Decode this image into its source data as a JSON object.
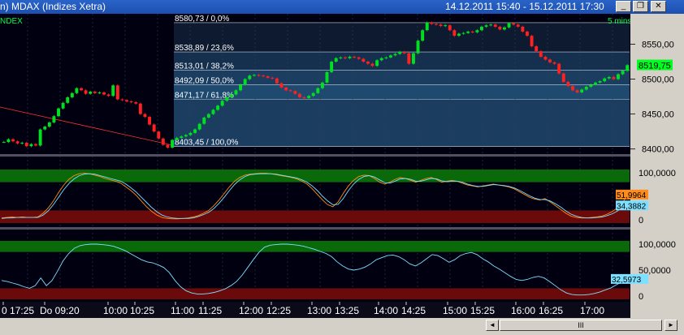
{
  "window": {
    "title": "n)   MDAX (Indizes Xetra)",
    "range": "14.12.2011 15:40 - 15.12.2011 17:30",
    "minimize": "_",
    "restore": "❐",
    "close": "✕"
  },
  "chart_data": [
    {
      "type": "candlestick",
      "instrument_label": "NDEX",
      "interval": "5 mins",
      "ylim": [
        8395,
        8590
      ],
      "yticks": [
        8550,
        8500,
        8450,
        8400
      ],
      "ytick_labels": [
        "8550,00",
        "8500,00",
        "8450,00",
        "8400,00"
      ],
      "last_price": 8519.75,
      "last_price_label": "8519,75",
      "fib_levels": [
        {
          "value": 8580.73,
          "label": "8580,73 / 0,0%"
        },
        {
          "value": 8538.89,
          "label": "8538,89 / 23,6%"
        },
        {
          "value": 8513.01,
          "label": "8513,01 / 38,2%"
        },
        {
          "value": 8492.09,
          "label": "8492,09 / 50,0%"
        },
        {
          "value": 8471.17,
          "label": "8471,17 / 61,8%"
        },
        {
          "value": 8403.45,
          "label": "8403,45 / 100,0%"
        }
      ],
      "trendline": {
        "from": [
          "Do 09:20",
          8460
        ],
        "to": [
          "11:00",
          8405
        ]
      },
      "close": [
        8410,
        8414,
        8411,
        8408,
        8409,
        8404,
        8407,
        8405,
        8428,
        8432,
        8438,
        8447,
        8458,
        8466,
        8474,
        8480,
        8487,
        8484,
        8479,
        8482,
        8480,
        8481,
        8478,
        8476,
        8491,
        8471,
        8470,
        8468,
        8467,
        8465,
        8450,
        8446,
        8435,
        8425,
        8415,
        8406,
        8402,
        8413,
        8416,
        8418,
        8420,
        8423,
        8428,
        8436,
        8445,
        8450,
        8456,
        8462,
        8469,
        8474,
        8478,
        8484,
        8492,
        8500,
        8505,
        8506,
        8505,
        8504,
        8502,
        8501,
        8494,
        8488,
        8484,
        8483,
        8479,
        8474,
        8473,
        8476,
        8480,
        8487,
        8495,
        8510,
        8525,
        8530,
        8531,
        8530,
        8532,
        8531,
        8529,
        8525,
        8522,
        8519,
        8527,
        8530,
        8531,
        8534,
        8536,
        8539,
        8537,
        8522,
        8537,
        8555,
        8570,
        8581,
        8579,
        8578,
        8576,
        8577,
        8570,
        8562,
        8565,
        8566,
        8568,
        8567,
        8570,
        8575,
        8577,
        8578,
        8575,
        8571,
        8574,
        8580,
        8578,
        8575,
        8568,
        8562,
        8547,
        8540,
        8532,
        8528,
        8524,
        8522,
        8508,
        8496,
        8490,
        8484,
        8481,
        8485,
        8489,
        8492,
        8495,
        8497,
        8501,
        8503,
        8500,
        8507,
        8512,
        8520
      ]
    },
    {
      "type": "line",
      "indicator": "stochastic",
      "ylim": [
        0,
        100
      ],
      "ytick_labels": [
        "100,0000",
        "0"
      ],
      "series": [
        {
          "color": "#ff8c1a",
          "values": [
            4,
            5,
            6,
            5,
            6,
            5,
            5,
            6,
            14,
            25,
            40,
            58,
            74,
            86,
            94,
            98,
            99,
            98,
            95,
            92,
            88,
            85,
            82,
            78,
            70,
            62,
            52,
            40,
            28,
            18,
            10,
            5,
            3,
            2,
            2,
            3,
            4,
            6,
            9,
            14,
            20,
            30,
            42,
            56,
            70,
            82,
            90,
            95,
            97,
            98,
            99,
            99,
            98,
            96,
            94,
            92,
            90,
            87,
            82,
            76,
            66,
            54,
            42,
            32,
            28,
            38,
            56,
            72,
            84,
            92,
            95,
            94,
            88,
            80,
            76,
            80,
            86,
            90,
            88,
            84,
            80,
            84,
            88,
            90,
            86,
            80,
            82,
            84,
            82,
            78,
            74,
            72,
            70,
            72,
            74,
            76,
            74,
            72,
            70,
            66,
            60,
            54,
            48,
            44,
            42,
            45,
            38,
            30,
            22,
            14,
            8,
            5,
            4,
            4,
            5,
            6,
            8,
            12,
            18,
            26,
            38,
            52
          ],
          "last_label": "51,9964"
        },
        {
          "color": "#7ee0ff",
          "values": [
            3,
            4,
            4,
            5,
            5,
            5,
            5,
            5,
            10,
            19,
            32,
            48,
            64,
            77,
            87,
            94,
            97,
            98,
            97,
            94,
            91,
            88,
            85,
            82,
            76,
            68,
            59,
            48,
            37,
            26,
            17,
            10,
            6,
            4,
            3,
            3,
            3,
            4,
            7,
            11,
            16,
            24,
            35,
            48,
            62,
            75,
            85,
            92,
            96,
            97,
            98,
            98,
            98,
            97,
            95,
            93,
            91,
            89,
            85,
            80,
            72,
            62,
            50,
            40,
            32,
            33,
            45,
            62,
            76,
            86,
            92,
            94,
            91,
            85,
            79,
            78,
            82,
            87,
            88,
            86,
            82,
            82,
            85,
            88,
            87,
            83,
            81,
            82,
            82,
            80,
            76,
            73,
            71,
            71,
            73,
            75,
            74,
            73,
            71,
            68,
            63,
            57,
            51,
            46,
            43,
            43,
            40,
            34,
            27,
            19,
            12,
            8,
            5,
            4,
            4,
            5,
            6,
            9,
            13,
            19,
            27,
            34
          ],
          "last_label": "34,3882"
        }
      ],
      "bands": {
        "upper": 80,
        "lower": 20
      }
    },
    {
      "type": "line",
      "indicator": "oscillator",
      "ylim": [
        0,
        100
      ],
      "ytick_labels": [
        "100,0000",
        "50,0000",
        "0"
      ],
      "series": [
        {
          "color": "#7ee0ff",
          "values": [
            30,
            28,
            25,
            22,
            18,
            15,
            20,
            35,
            20,
            30,
            48,
            68,
            82,
            92,
            97,
            99,
            100,
            100,
            99,
            98,
            96,
            92,
            88,
            82,
            76,
            70,
            66,
            64,
            60,
            55,
            45,
            30,
            18,
            10,
            6,
            4,
            4,
            5,
            7,
            10,
            14,
            20,
            28,
            40,
            55,
            70,
            84,
            94,
            98,
            99,
            100,
            100,
            99,
            98,
            96,
            93,
            90,
            86,
            82,
            76,
            66,
            58,
            52,
            50,
            52,
            56,
            62,
            70,
            74,
            78,
            79,
            76,
            70,
            62,
            58,
            64,
            72,
            80,
            78,
            72,
            65,
            70,
            78,
            82,
            84,
            80,
            72,
            66,
            58,
            52,
            45,
            38,
            32,
            30,
            32,
            36,
            38,
            35,
            28,
            20,
            12,
            6,
            3,
            2,
            2,
            3,
            5,
            8,
            12,
            16,
            22,
            28,
            33
          ],
          "last_label": "32,5973"
        }
      ],
      "bands": {
        "upper": 85,
        "lower": 15
      }
    }
  ],
  "x_axis": {
    "labels": [
      "0 17:25",
      "Do 09:20",
      "10:00",
      "10:25",
      "11:00",
      "11:25",
      "12:00",
      "12:25",
      "13:00",
      "13:25",
      "14:00",
      "14:25",
      "15:00",
      "15:25",
      "16:00",
      "16:25",
      "17:00"
    ]
  },
  "scrollbar": {
    "thumb_label": "III",
    "left_arrow": "◄",
    "right_arrow": "►"
  }
}
